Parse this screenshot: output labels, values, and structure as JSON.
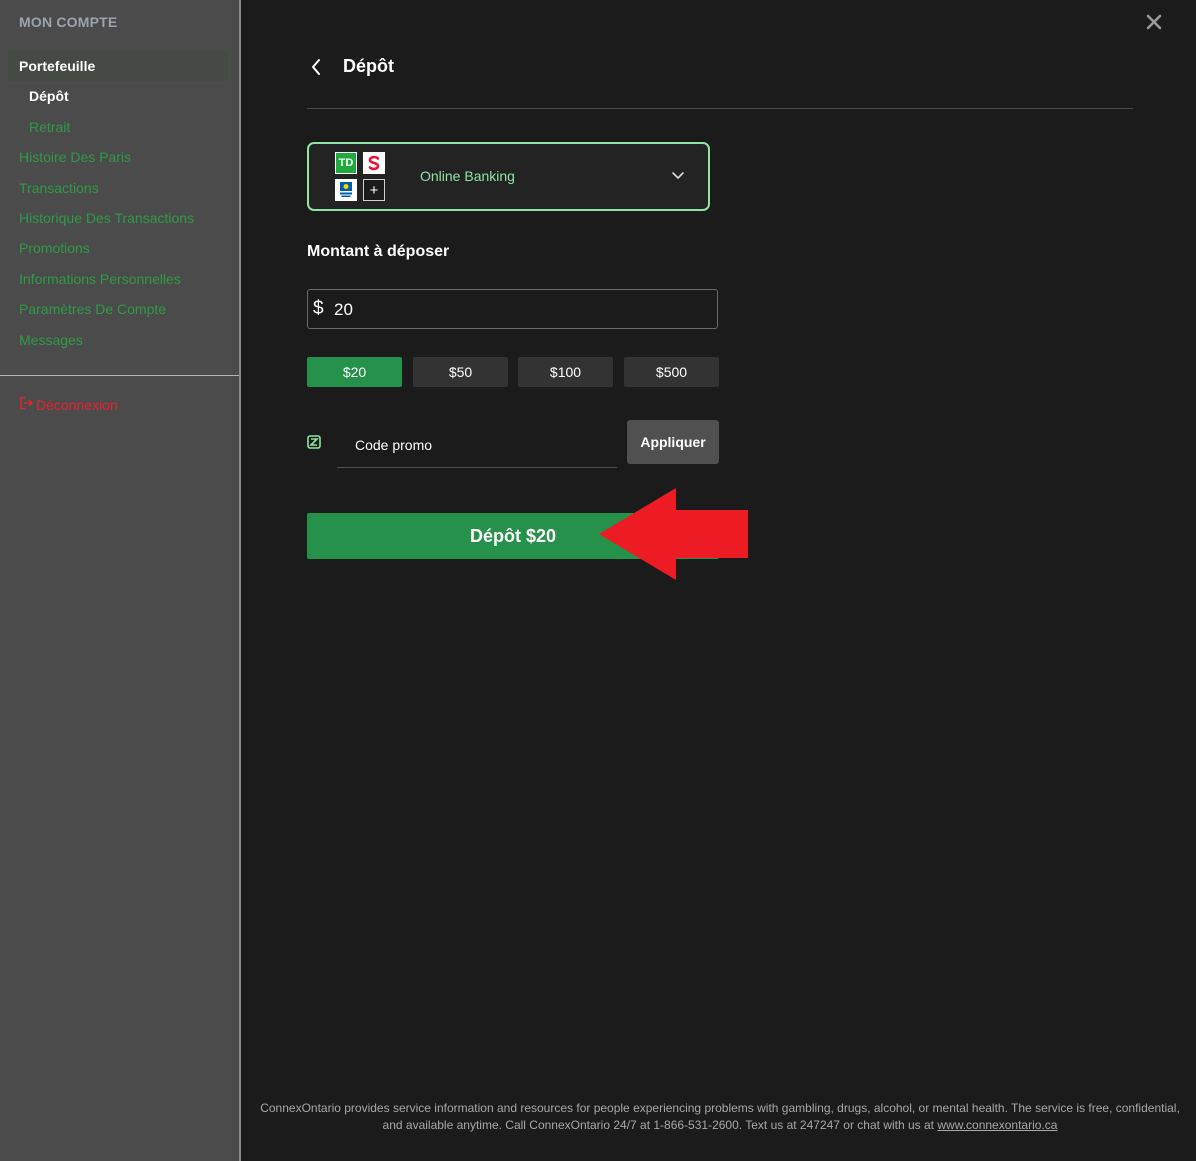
{
  "sidebar": {
    "title": "MON COMPTE",
    "wallet_label": "Portefeuille",
    "deposit_label": "Dépôt",
    "withdraw_label": "Retrait",
    "items": [
      {
        "label": "Histoire Des Paris"
      },
      {
        "label": "Transactions"
      },
      {
        "label": "Historique Des Transactions"
      },
      {
        "label": "Promotions"
      },
      {
        "label": "Informations Personnelles"
      },
      {
        "label": "Paramètres De Compte"
      },
      {
        "label": "Messages"
      }
    ],
    "logout_label": "Déconnexion"
  },
  "header": {
    "title": "Dépôt"
  },
  "payment_method": {
    "label": "Online Banking",
    "logos": [
      "td-bank-logo",
      "scotiabank-logo",
      "rbc-logo",
      "plus-icon"
    ],
    "td_text": "TD"
  },
  "amount": {
    "label": "Montant à déposer",
    "currency_symbol": "$",
    "value": "20",
    "presets": [
      {
        "label": "$20",
        "active": true
      },
      {
        "label": "$50",
        "active": false
      },
      {
        "label": "$100",
        "active": false
      },
      {
        "label": "$500",
        "active": false
      }
    ]
  },
  "promo": {
    "placeholder": "Code promo",
    "apply_label": "Appliquer"
  },
  "deposit_button": {
    "label": "Dépôt $20"
  },
  "footer": {
    "text": "ConnexOntario provides service information and resources for people experiencing problems with gambling, drugs, alcohol, or mental health. The service is free, confidential, and available anytime. Call ConnexOntario 24/7 at 1-866-531-2600. Text us at 247247 or chat with us at",
    "link_text": "www.connexontario.ca"
  },
  "colors": {
    "accent_green": "#26914a",
    "highlight_green": "#8fe3a3",
    "annotation_red": "#ed1c24",
    "logout_red": "#e4232e"
  }
}
